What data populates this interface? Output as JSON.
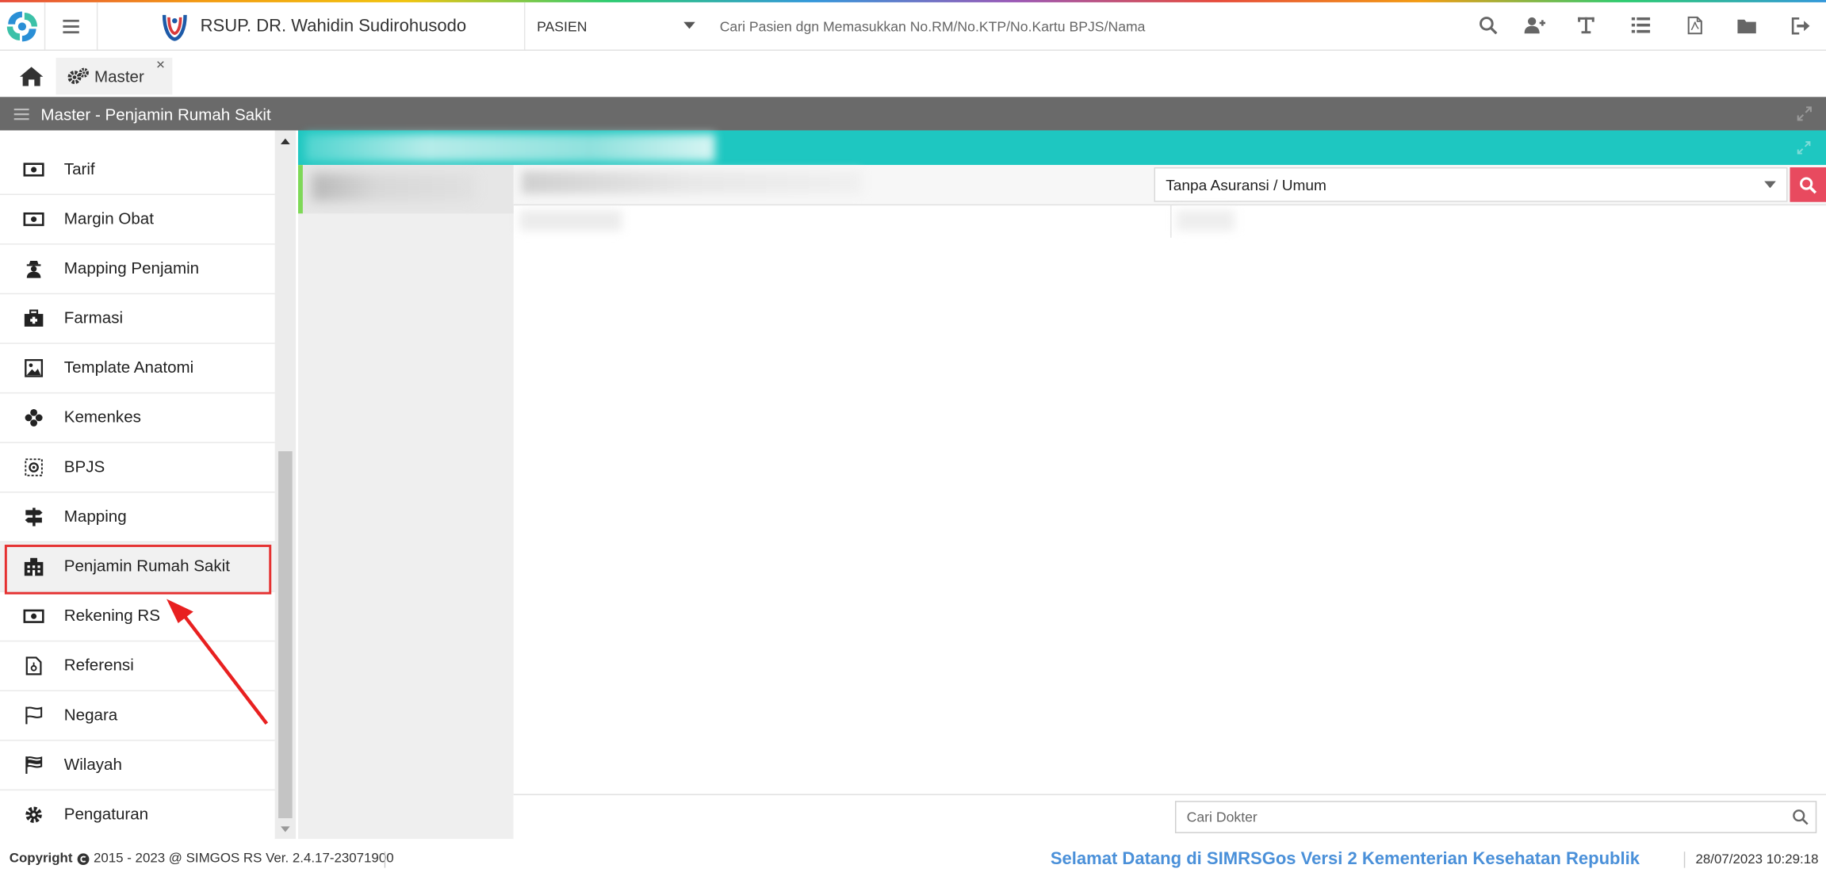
{
  "header": {
    "hospital_name": "RSUP. DR. Wahidin Sudirohusodo",
    "patient_select_label": "PASIEN",
    "search_placeholder": "Cari Pasien dgn Memasukkan No.RM/No.KTP/No.Kartu BPJS/Nama",
    "icons": [
      "search-icon",
      "add-user-icon",
      "text-icon",
      "list-icon",
      "pdf-icon",
      "folder-icon",
      "logout-icon"
    ]
  },
  "tabs": {
    "home_icon": "home-icon",
    "master_label": "Master",
    "close_glyph": "×"
  },
  "titlebar": {
    "title": "Master - Penjamin Rumah Sakit"
  },
  "sidebar": {
    "items": [
      {
        "label": "Tarif",
        "icon": "money-icon"
      },
      {
        "label": "Margin Obat",
        "icon": "money-icon"
      },
      {
        "label": "Mapping Penjamin",
        "icon": "user-secret-icon"
      },
      {
        "label": "Farmasi",
        "icon": "medkit-icon"
      },
      {
        "label": "Template Anatomi",
        "icon": "image-icon"
      },
      {
        "label": "Kemenkes",
        "icon": "flower-icon"
      },
      {
        "label": "BPJS",
        "icon": "gear-outline-icon"
      },
      {
        "label": "Mapping",
        "icon": "signpost-icon"
      },
      {
        "label": "Penjamin Rumah Sakit",
        "icon": "building-icon",
        "active": true
      },
      {
        "label": "Rekening RS",
        "icon": "money-icon"
      },
      {
        "label": "Referensi",
        "icon": "document-icon"
      },
      {
        "label": "Negara",
        "icon": "flag-outline-icon"
      },
      {
        "label": "Wilayah",
        "icon": "checkered-flag-icon"
      },
      {
        "label": "Pengaturan",
        "icon": "gear-icon"
      }
    ]
  },
  "content": {
    "insurer_select_value": "Tanpa Asuransi / Umum",
    "doctor_search_placeholder": "Cari Dokter"
  },
  "statusbar": {
    "copyright": "Copyright",
    "copyright_rest": "2015 - 2023 @ SIMGOS RS Ver. 2.4.17-23071900",
    "welcome": "Selamat Datang di SIMRSGos Versi 2 Kementerian Kesehatan Republik",
    "datetime": "28/07/2023 10:29:18"
  },
  "colors": {
    "teal_bar": "#1ec7c1",
    "titlebar": "#6a6a6a",
    "search_button": "#e84a5f",
    "welcome_text": "#4a90d9",
    "highlight_box": "#e53030",
    "active_accent": "#7ed957"
  }
}
